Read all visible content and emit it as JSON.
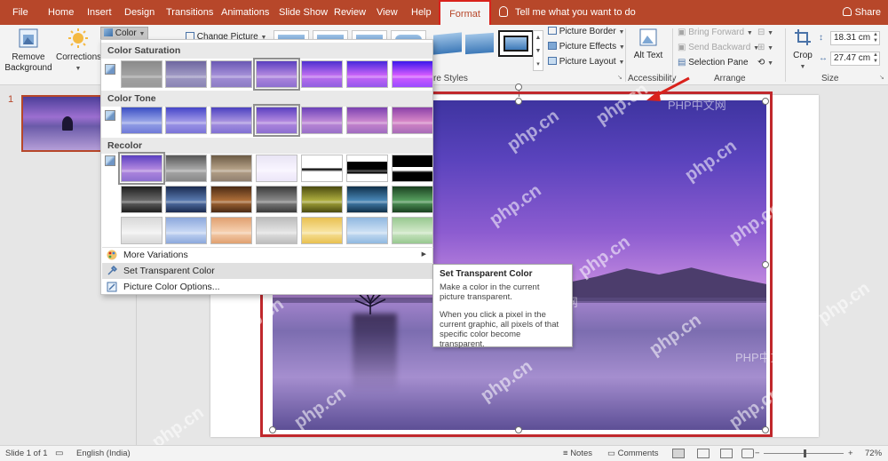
{
  "tabs": [
    {
      "label": "File"
    },
    {
      "label": "Home"
    },
    {
      "label": "Insert"
    },
    {
      "label": "Design"
    },
    {
      "label": "Transitions"
    },
    {
      "label": "Animations"
    },
    {
      "label": "Slide Show"
    },
    {
      "label": "Review"
    },
    {
      "label": "View"
    },
    {
      "label": "Help"
    },
    {
      "label": "Format"
    }
  ],
  "tell_me": "Tell me what you want to do",
  "share": "Share",
  "ribbon": {
    "remove_background": "Remove Background",
    "corrections": "Corrections",
    "color": "Color",
    "change_picture": "Change Picture",
    "picture_border": "Picture Border",
    "picture_effects": "Picture Effects",
    "picture_layout": "Picture Layout",
    "picture_styles_group": "re Styles",
    "alt_text": "Alt Text",
    "accessibility_group": "Accessibility",
    "bring_forward": "Bring Forward",
    "send_backward": "Send Backward",
    "selection_pane": "Selection Pane",
    "arrange_group": "Arrange",
    "crop": "Crop",
    "height": "18.31 cm",
    "width": "27.47 cm",
    "size_group": "Size"
  },
  "dropdown": {
    "saturation_head": "Color Saturation",
    "tone_head": "Color Tone",
    "recolor_head": "Recolor",
    "more_variations": "More Variations",
    "set_transparent": "Set Transparent Color",
    "picture_color_options": "Picture Color Options..."
  },
  "tooltip": {
    "title": "Set Transparent Color",
    "line1": "Make a color in the current picture transparent.",
    "line2": "When you click a pixel in the current graphic, all pixels of that specific color become transparent."
  },
  "slide_number": "1",
  "status": {
    "slide_of": "Slide 1 of 1",
    "language": "English (India)",
    "notes": "Notes",
    "comments": "Comments",
    "zoom": "72%"
  },
  "watermarks": {
    "php_cn": "php.cn",
    "php_cn_label": "PHP中文网"
  },
  "colors": {
    "accent": "#b7472a",
    "selection_red": "#c0282c",
    "ribbon_bg": "#f3f3f3"
  }
}
